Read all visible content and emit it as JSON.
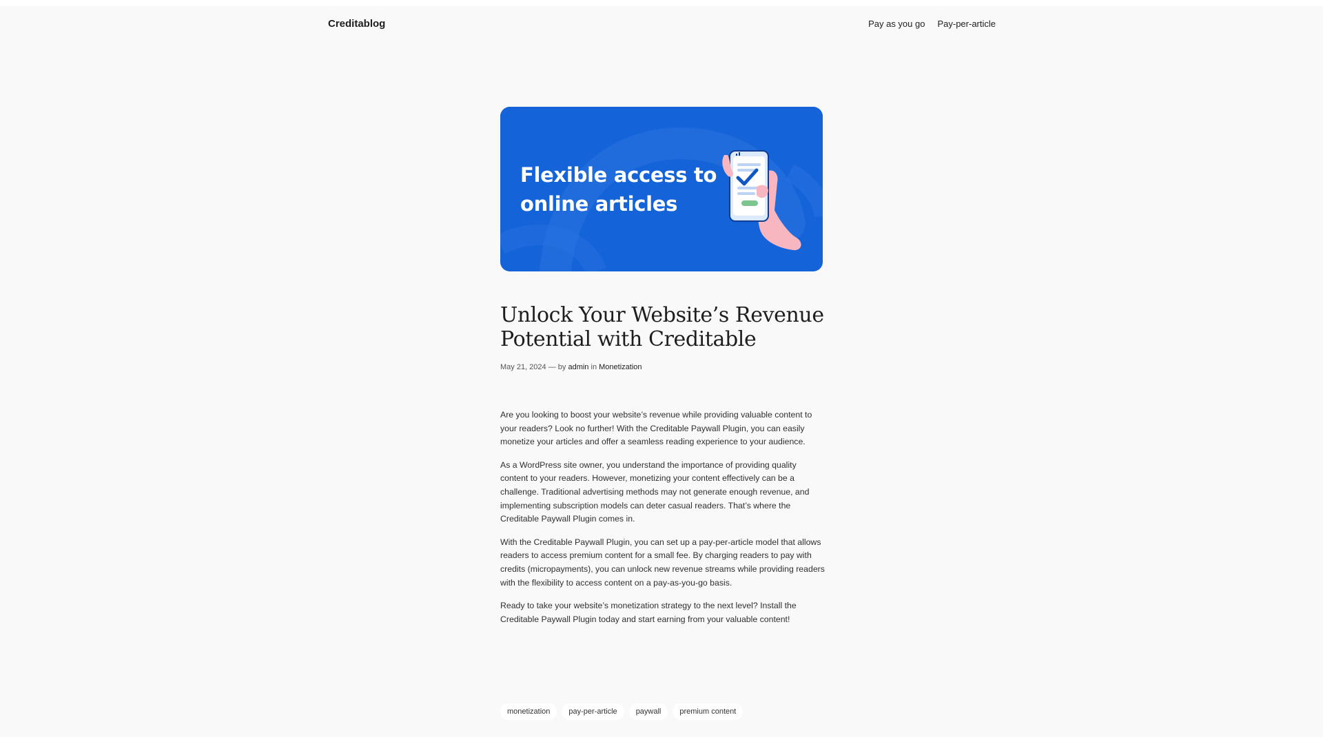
{
  "header": {
    "site_title": "Creditablog",
    "nav": [
      {
        "label": "Pay as you go"
      },
      {
        "label": "Pay-per-article"
      }
    ]
  },
  "hero": {
    "line1": "Flexible access to",
    "line2": "online articles",
    "icon": "phone-in-hand-checkmark-illustration",
    "background_color": "#1463d8"
  },
  "post": {
    "title": "Unlock Your Website’s Revenue Potential with Creditable",
    "date": "May 21, 2024",
    "separator": "—",
    "by": "by",
    "author": "admin",
    "in": "in",
    "category": "Monetization",
    "paragraphs": [
      "Are you looking to boost your website’s revenue while providing valuable content to your readers? Look no further! With the Creditable Paywall Plugin, you can easily monetize your articles and offer a seamless reading experience to your audience.",
      "As a WordPress site owner, you understand the importance of providing quality content to your readers. However, monetizing your content effectively can be a challenge. Traditional advertising methods may not generate enough revenue, and implementing subscription models can deter casual readers. That’s where the Creditable Paywall Plugin comes in.",
      "With the Creditable Paywall Plugin, you can set up a pay-per-article model that allows readers to access premium content for a small fee. By charging readers to pay with credits (micropayments), you can unlock new revenue streams while providing readers with the flexibility to access content on a pay-as-you-go basis.",
      "Ready to take your website’s monetization strategy to the next level? Install the Creditable Paywall Plugin today and start earning from your valuable content!"
    ],
    "tags": [
      {
        "label": "monetization"
      },
      {
        "label": "pay-per-article"
      },
      {
        "label": "paywall"
      },
      {
        "label": "premium content"
      }
    ]
  }
}
